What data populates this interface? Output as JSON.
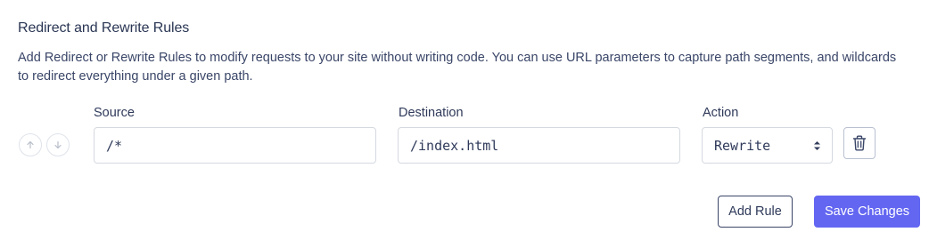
{
  "section": {
    "title": "Redirect and Rewrite Rules",
    "description": "Add Redirect or Rewrite Rules to modify requests to your site without writing code. You can use URL parameters to capture path segments, and wildcards to redirect everything under a given path."
  },
  "columns": {
    "source": "Source",
    "destination": "Destination",
    "action": "Action"
  },
  "rules": [
    {
      "source": "/*",
      "destination": "/index.html",
      "action": "Rewrite"
    }
  ],
  "icons": {
    "move_up": "arrow-up-icon",
    "move_down": "arrow-down-icon",
    "delete": "trash-icon",
    "select": "select-caret-icon"
  },
  "buttons": {
    "add_rule": "Add Rule",
    "save_changes": "Save Changes"
  },
  "colors": {
    "primary": "#6366f1",
    "text": "#2f3a5a"
  }
}
